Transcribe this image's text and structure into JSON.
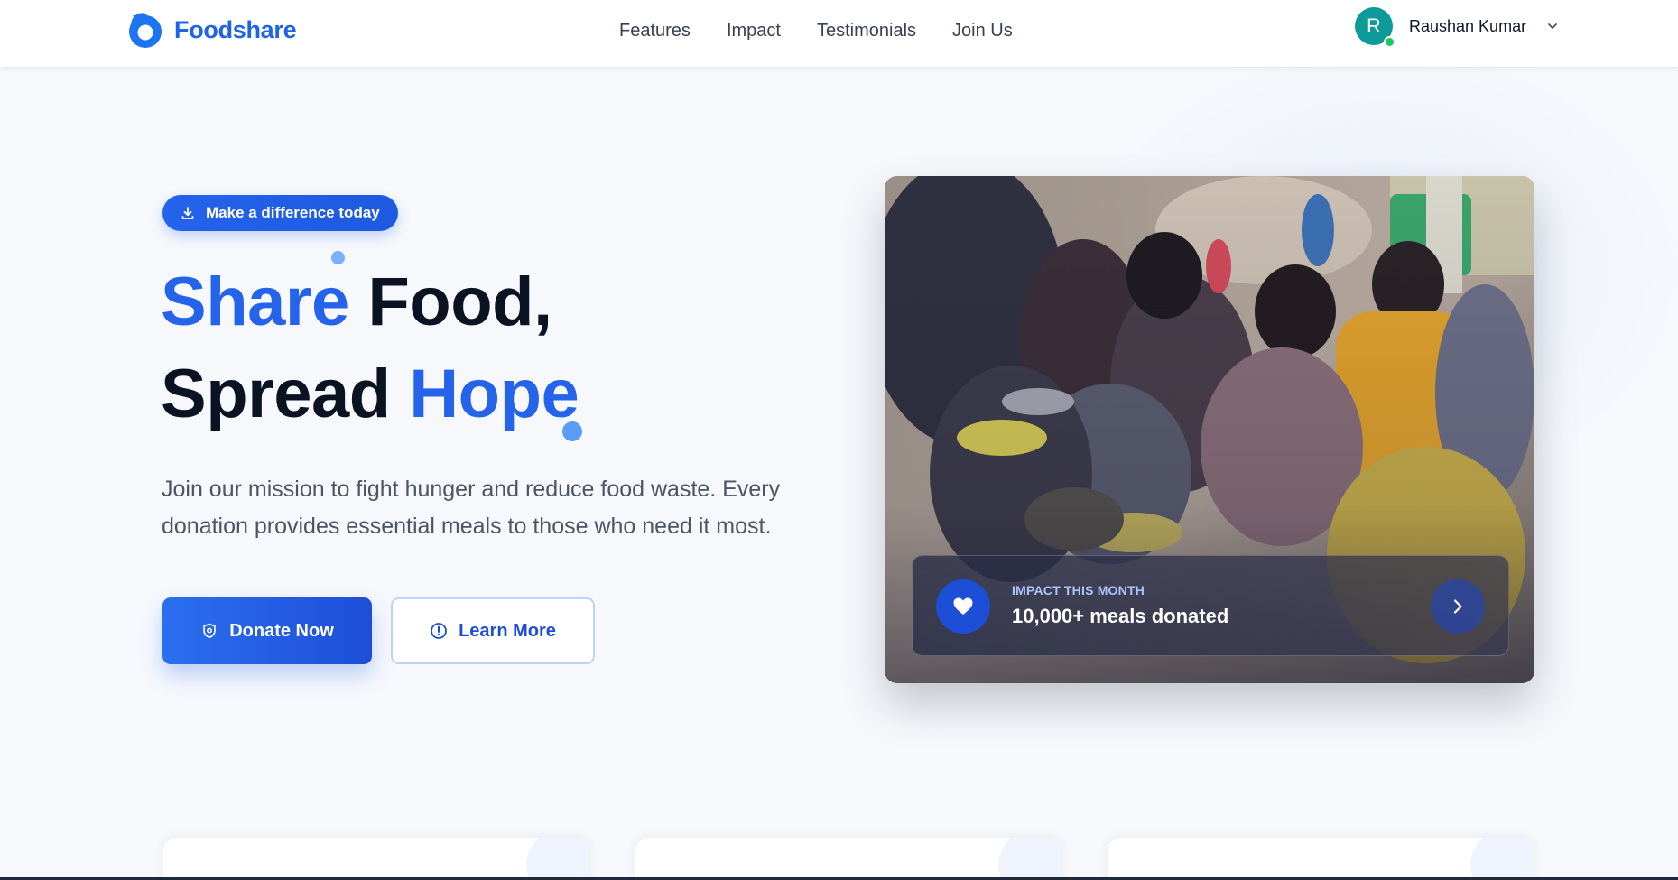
{
  "header": {
    "brand_name": "Foodshare",
    "nav": [
      "Features",
      "Impact",
      "Testimonials",
      "Join Us"
    ],
    "user": {
      "initial": "R",
      "name": "Raushan Kumar"
    }
  },
  "hero": {
    "badge": "Make a difference today",
    "headline": {
      "line1_accent": "Share",
      "line1_rest": " Food,",
      "line2_start": "Spread ",
      "line2_accent": "Hope"
    },
    "subtitle": "Join our mission to fight hunger and reduce food waste. Every donation provides essential meals to those who need it most.",
    "donate_label": "Donate Now",
    "learn_label": "Learn More",
    "impact": {
      "label": "IMPACT THIS MONTH",
      "value": "10,000+ meals donated"
    }
  },
  "colors": {
    "primary": "#2563eb",
    "brand": "#1d64e8",
    "avatar": "#0f9a9a",
    "online": "#22c55e"
  },
  "icons": {
    "logo": "water-drop-logo",
    "badge": "download-icon",
    "donate": "shield-icon",
    "learn": "info-circle-icon",
    "impact": "heart-icon",
    "next": "chevron-right-icon",
    "user_menu": "chevron-down-icon"
  }
}
